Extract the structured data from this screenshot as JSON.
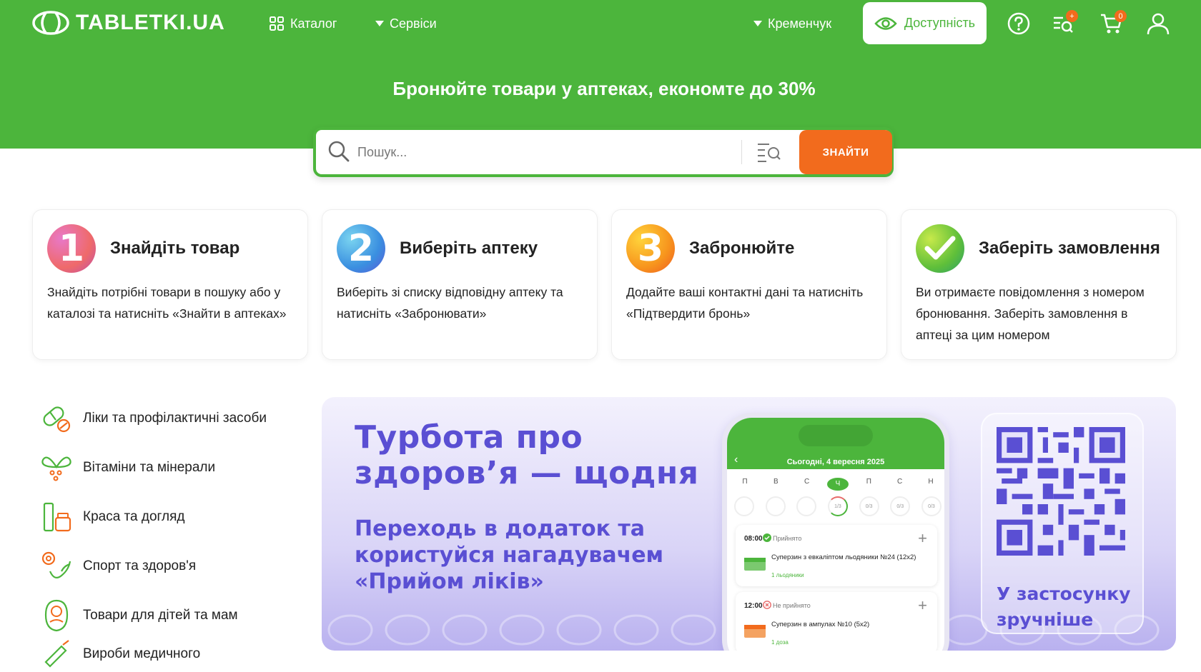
{
  "header": {
    "logo_text": "TABLETKI.UA",
    "catalog_label": "Каталог",
    "services_label": "Сервіси",
    "city_label": "Кременчук",
    "accessibility_label": "Доступність",
    "search_list_badge": "+",
    "cart_count": "0",
    "tagline": "Бронюйте товари у аптеках, економте до 30%"
  },
  "search": {
    "placeholder": "Пошук...",
    "button_label": "ЗНАЙТИ"
  },
  "steps": [
    {
      "number": "1",
      "title": "Знайдіть товар",
      "text": "Знайдіть потрібні товари в пошуку або у каталозі та натисніть «Знайти в аптеках»"
    },
    {
      "number": "2",
      "title": "Виберіть аптеку",
      "text": "Виберіть зі списку відповідну аптеку та натисніть «Забронювати»"
    },
    {
      "number": "3",
      "title": "Забронюйте",
      "text": "Додайте ваші контактні дані та натисніть «Підтвердити бронь»"
    },
    {
      "number": "",
      "title": "Заберіть замовлення",
      "text": "Ви отримаєте повідомлення з номером бронювання. Заберіть замовлення в аптеці за цим номером"
    }
  ],
  "categories": [
    {
      "label": "Ліки та профілактичні засоби",
      "icon": "pills-icon"
    },
    {
      "label": "Вітаміни та мінерали",
      "icon": "vitamins-icon"
    },
    {
      "label": "Краса та догляд",
      "icon": "cosmetics-icon"
    },
    {
      "label": "Спорт та здоров'я",
      "icon": "sport-icon"
    },
    {
      "label": "Товари для дітей та мам",
      "icon": "baby-icon"
    },
    {
      "label": "Вироби медичного",
      "icon": "medical-icon"
    }
  ],
  "banner": {
    "title": "Турбота про\nздоров’я — щодня",
    "subtitle": "Переходь в додаток та\nкористуйся нагадувачем\n«Прийом ліків»",
    "phone": {
      "date_label": "Сьогодні, 4 вересня 2025",
      "days": [
        "П",
        "В",
        "С",
        "Ч",
        "П",
        "С",
        "Н"
      ],
      "active_day_index": 3,
      "rings": [
        "",
        "",
        "",
        "1/3",
        "0/3",
        "0/3",
        "0/3"
      ],
      "items": [
        {
          "time": "08:00",
          "status": "Прийнято",
          "name": "Суперзин з евкаліптом льодяники №24 (12х2)",
          "dose": "1 льодяники"
        },
        {
          "time": "12:00",
          "status": "Не прийнято",
          "name": "Суперзин в ампулах №10 (5х2)",
          "dose": "1 доза"
        }
      ]
    },
    "qr_caption": "У застосунку зручніше"
  },
  "colors": {
    "brand_green": "#4cb53c",
    "accent_orange": "#f26b1d",
    "banner_purple": "#5a4fd3"
  }
}
